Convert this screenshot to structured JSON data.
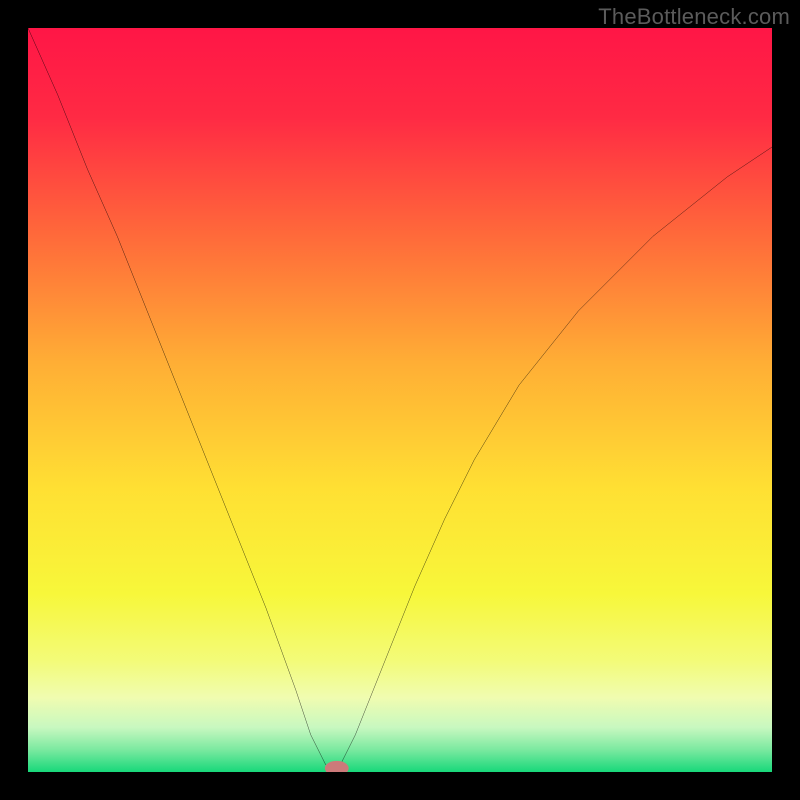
{
  "watermark": "TheBottleneck.com",
  "chart_data": {
    "type": "line",
    "title": "",
    "xlabel": "",
    "ylabel": "",
    "xlim": [
      0,
      100
    ],
    "ylim": [
      0,
      100
    ],
    "grid": false,
    "series": [
      {
        "name": "curve",
        "stroke": "#000000",
        "x": [
          0,
          4,
          8,
          12,
          16,
          20,
          24,
          28,
          32,
          36,
          38,
          40,
          41,
          42,
          44,
          48,
          52,
          56,
          60,
          66,
          74,
          84,
          94,
          100
        ],
        "values": [
          100,
          91,
          81,
          72,
          62,
          52,
          42,
          32,
          22,
          11,
          5,
          1,
          0,
          1,
          5,
          15,
          25,
          34,
          42,
          52,
          62,
          72,
          80,
          84
        ]
      }
    ],
    "marker": {
      "name": "optimum",
      "x": 41.5,
      "y": 0.5,
      "rx": 1.6,
      "ry": 1.0,
      "fill": "#cc7a7a"
    },
    "background_gradient": {
      "stops": [
        {
          "offset": 0.0,
          "color": "#ff1646"
        },
        {
          "offset": 0.12,
          "color": "#ff2a44"
        },
        {
          "offset": 0.28,
          "color": "#ff6a3a"
        },
        {
          "offset": 0.45,
          "color": "#ffae35"
        },
        {
          "offset": 0.62,
          "color": "#ffe033"
        },
        {
          "offset": 0.76,
          "color": "#f7f73a"
        },
        {
          "offset": 0.85,
          "color": "#f3fb78"
        },
        {
          "offset": 0.9,
          "color": "#f0fcb0"
        },
        {
          "offset": 0.94,
          "color": "#c8f8c0"
        },
        {
          "offset": 0.97,
          "color": "#7be9a0"
        },
        {
          "offset": 1.0,
          "color": "#18d87a"
        }
      ]
    }
  }
}
